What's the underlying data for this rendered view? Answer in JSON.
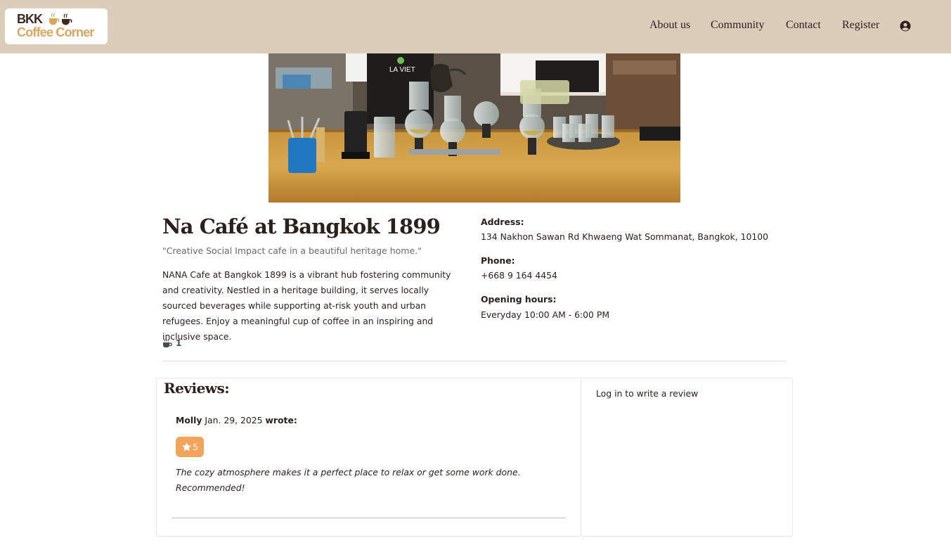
{
  "header": {
    "logo_line1": "BKK",
    "logo_line2": "Coffee Corner",
    "nav": {
      "about": "About us",
      "community": "Community",
      "contact": "Contact",
      "register": "Register"
    },
    "user_icon": "user-circle-icon"
  },
  "hero": {
    "alt": "Baristas brewing coffee with siphon equipment on a wooden counter",
    "apron_text": "LA VIET"
  },
  "cafe": {
    "name": "Na Café at Bangkok 1899",
    "tagline": "\"Creative Social Impact cafe in a beautiful heritage home.\"",
    "description": "NANA Cafe at Bangkok 1899 is a vibrant hub fostering community and creativity. Nestled in a heritage building, it serves locally sourced beverages while supporting at-risk youth and urban refugees. Enjoy a meaningful cup of coffee in an inspiring and inclusive space.",
    "rating_icon": "coffee-cup-icon",
    "rating_count": "1",
    "address_label": "Address:",
    "address": "134 Nakhon Sawan Rd Khwaeng Wat Sommanat, Bangkok, 10100",
    "phone_label": "Phone:",
    "phone": "+668 9 164 4454",
    "hours_label": "Opening hours:",
    "hours": "Everyday 10:00 AM - 6:00 PM"
  },
  "reviews": {
    "heading": "Reviews:",
    "items": [
      {
        "author": "Molly",
        "date": "Jan. 29, 2025",
        "wrote": "wrote:",
        "score": "5",
        "text": "The cozy atmosphere makes it a perfect place to relax or get some work done. Recommended!"
      }
    ],
    "login_prompt": "Log in to write a review"
  },
  "colors": {
    "navbar_bg": "#dccdbb",
    "logo_accent": "#d9a65e",
    "badge_bg": "#f2a55a",
    "text_dark": "#2b211c"
  }
}
